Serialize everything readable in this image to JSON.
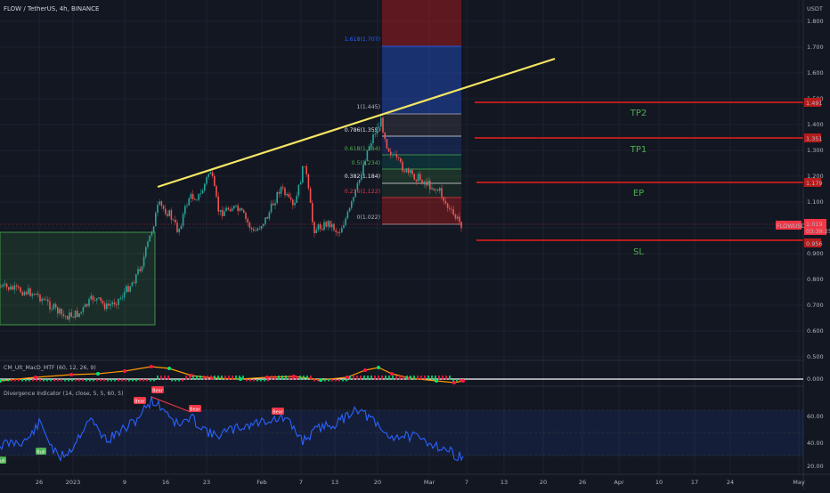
{
  "header": {
    "symbol": "FLOW / TetherUS, 4h, BINANCE",
    "currency": "USDT"
  },
  "price_axis": {
    "labels": [
      "1.800",
      "1.700",
      "1.600",
      "1.500",
      "1.400",
      "1.300",
      "1.200",
      "1.100",
      "1.000",
      "0.900",
      "0.800",
      "0.700",
      "0.600",
      "0.500"
    ],
    "tags": [
      {
        "text": "1.491",
        "color": "#b71c1c"
      },
      {
        "text": "1.351",
        "color": "#b71c1c"
      },
      {
        "text": "1.179",
        "color": "#b71c1c"
      },
      {
        "text": "0.956",
        "color": "#b71c1c"
      }
    ],
    "current": {
      "price": "1.019",
      "countdown": "03:38:25",
      "symbol_tag": "FLOWUSDT",
      "color": "#f23645"
    }
  },
  "time_axis": [
    "26",
    "2023",
    "9",
    "16",
    "23",
    "Feb",
    "7",
    "13",
    "20",
    "Mar",
    "7",
    "13",
    "20",
    "26",
    "Apr",
    "10",
    "17",
    "24",
    "May"
  ],
  "fib": {
    "levels": [
      {
        "text": "1.618(1.707)",
        "color": "#2962ff"
      },
      {
        "text": "1(1.445)",
        "color": "#b2b5be"
      },
      {
        "text": "0.786(1.355)",
        "color": "#e0e3eb"
      },
      {
        "text": "0.618(1.284)",
        "color": "#4caf50"
      },
      {
        "text": "0.5(1.234)",
        "color": "#4caf50"
      },
      {
        "text": "0.382(1.184)",
        "color": "#e0e3eb"
      },
      {
        "text": "0.236(1.122)",
        "color": "#f23645"
      },
      {
        "text": "0(1.022)",
        "color": "#b2b5be"
      }
    ]
  },
  "zones": [
    {
      "label": "TP2",
      "price": 1.491
    },
    {
      "label": "TP1",
      "price": 1.351
    },
    {
      "label": "EP",
      "price": 1.179
    },
    {
      "label": "SL",
      "price": 0.956
    }
  ],
  "indicators": {
    "macd": {
      "title": "CM_Ult_MacD_MTF (60, 12, 26, 9)",
      "value": "0.000"
    },
    "divergence": {
      "title": "Divergence Indicator (14, close, 5, 5, 60, 5)",
      "axis": [
        "60.00",
        "40.00",
        "20.00"
      ],
      "bull_label": "Bull",
      "bear_label": "Bear"
    }
  },
  "colors": {
    "background": "#131722",
    "up": "#26a69a",
    "down": "#ef5350",
    "trendline": "#f5e663",
    "level_line": "#b71c1c",
    "zone_text": "#4caf50",
    "rsi": "#2962ff"
  }
}
